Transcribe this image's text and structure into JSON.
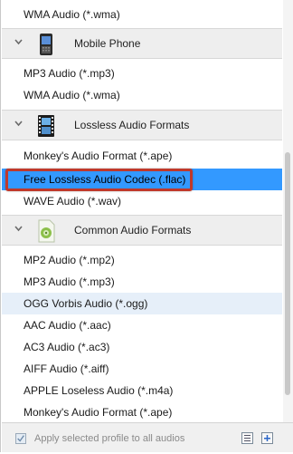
{
  "list": {
    "top_item": "WMA Audio (*.wma)",
    "groups": [
      {
        "name": "Mobile Phone",
        "icon": "mobile-phone-icon",
        "items": [
          "MP3 Audio (*.mp3)",
          "WMA Audio (*.wma)"
        ]
      },
      {
        "name": "Lossless Audio Formats",
        "icon": "film-strip-icon",
        "items": [
          "Monkey's Audio Format (*.ape)",
          "Free Lossless Audio Codec (.flac)",
          "WAVE Audio (*.wav)"
        ]
      },
      {
        "name": "Common Audio Formats",
        "icon": "audio-file-icon",
        "items": [
          "MP2 Audio (*.mp2)",
          "MP3 Audio (*.mp3)",
          "OGG Vorbis Audio (*.ogg)",
          "AAC Audio (*.aac)",
          "AC3 Audio (*.ac3)",
          "AIFF Audio (*.aiff)",
          "APPLE Loseless Audio (*.m4a)",
          "Monkey's Audio Format (*.ape)"
        ]
      }
    ],
    "selected_item": "Free Lossless Audio Codec (.flac)",
    "hovered_item": "OGG Vorbis Audio (*.ogg)"
  },
  "footer": {
    "apply_all_label": "Apply selected profile to all audios",
    "apply_all_checked": true,
    "buttons": [
      "collapse-icon",
      "expand-icon"
    ]
  },
  "colors": {
    "selection": "#3399ff",
    "hover": "#e6eff9",
    "highlight_border": "#c0392b",
    "group_header": "#eeeeee"
  }
}
